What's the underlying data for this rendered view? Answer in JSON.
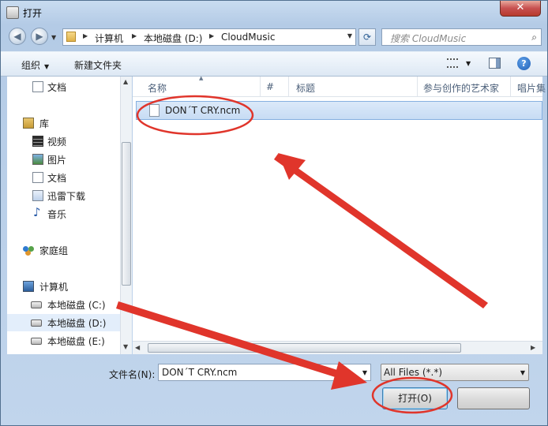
{
  "window": {
    "title": "打开",
    "close_glyph": "✕"
  },
  "nav": {
    "breadcrumbs": [
      "计算机",
      "本地磁盘 (D:)",
      "CloudMusic"
    ],
    "search_placeholder": "搜索 CloudMusic"
  },
  "toolbar": {
    "organize_label": "组织",
    "new_folder_label": "新建文件夹",
    "help_glyph": "?"
  },
  "sidebar": {
    "items": [
      {
        "label": "文档",
        "icon": "document-icon"
      },
      {
        "label": "库",
        "icon": "library-icon"
      },
      {
        "label": "视频",
        "icon": "video-icon"
      },
      {
        "label": "图片",
        "icon": "pictures-icon"
      },
      {
        "label": "文档",
        "icon": "document-icon"
      },
      {
        "label": "迅雷下载",
        "icon": "download-folder-icon"
      },
      {
        "label": "音乐",
        "icon": "music-icon"
      },
      {
        "label": "家庭组",
        "icon": "homegroup-icon"
      },
      {
        "label": "计算机",
        "icon": "computer-icon"
      },
      {
        "label": "本地磁盘 (C:)",
        "icon": "disk-icon"
      },
      {
        "label": "本地磁盘 (D:)",
        "icon": "disk-icon",
        "selected": true
      },
      {
        "label": "本地磁盘 (E:)",
        "icon": "disk-icon"
      }
    ]
  },
  "file_list": {
    "columns": [
      "名称",
      "#",
      "标题",
      "参与创作的艺术家",
      "唱片集"
    ],
    "files": [
      {
        "name": "DON´T CRY.ncm",
        "selected": true
      }
    ]
  },
  "footer": {
    "filename_label": "文件名(N):",
    "filename_value": "DON´T CRY.ncm",
    "filter_value": "All Files (*.*)",
    "open_label": "打开(O)",
    "cancel_label": ""
  },
  "annotation": {
    "color": "#e0352b"
  }
}
